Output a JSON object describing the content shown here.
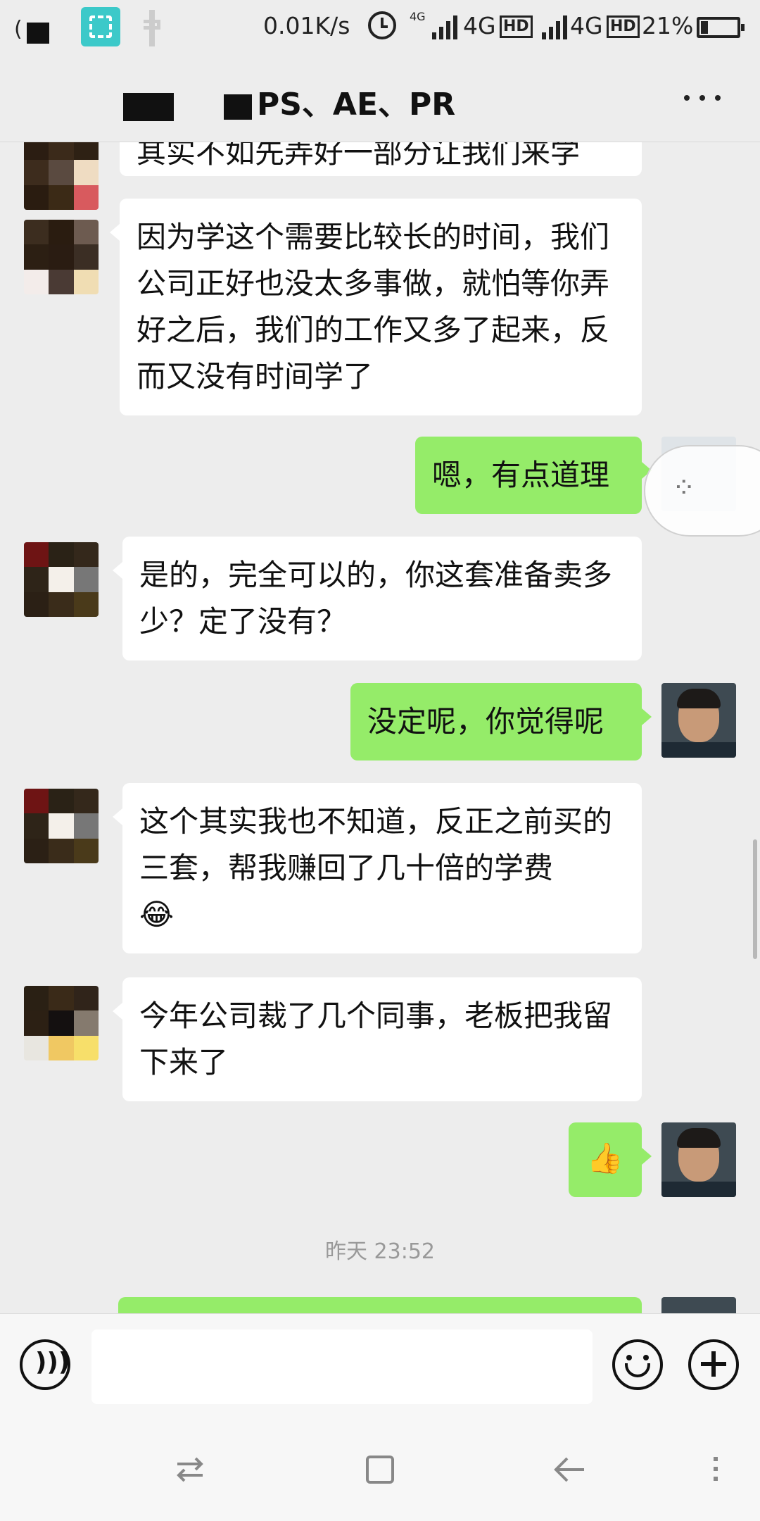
{
  "status_bar": {
    "net_speed": "0.01K/s",
    "net1": "4G",
    "net2": "4G",
    "hd1": "HD",
    "hd2": "HD",
    "battery": "21%"
  },
  "header": {
    "title": "PS、AE、PR"
  },
  "messages": [
    {
      "side": "left",
      "text": "其实不如先弄好一部分让我们来学"
    },
    {
      "side": "left",
      "text": "因为学这个需要比较长的时间，我们公司正好也没太多事做，就怕等你弄好之后，我们的工作又多了起来，反而又没有时间学了"
    },
    {
      "side": "right",
      "text": "嗯，有点道理"
    },
    {
      "side": "left",
      "text": "是的，完全可以的，你这套准备卖多少？定了没有？"
    },
    {
      "side": "right",
      "text": "没定呢，你觉得呢"
    },
    {
      "side": "left",
      "text": "这个其实我也不知道，反正之前买的三套，帮我赚回了几十倍的学费"
    },
    {
      "side": "left",
      "text": "今年公司裁了几个同事，老板把我留下来了"
    },
    {
      "side": "right",
      "text": "👍"
    }
  ],
  "timestamp": "昨天 23:52",
  "emoji_laugh": "😂",
  "colors": {
    "bg": "#ededed",
    "bubble_right": "#95ec69",
    "bubble_left": "#ffffff"
  }
}
